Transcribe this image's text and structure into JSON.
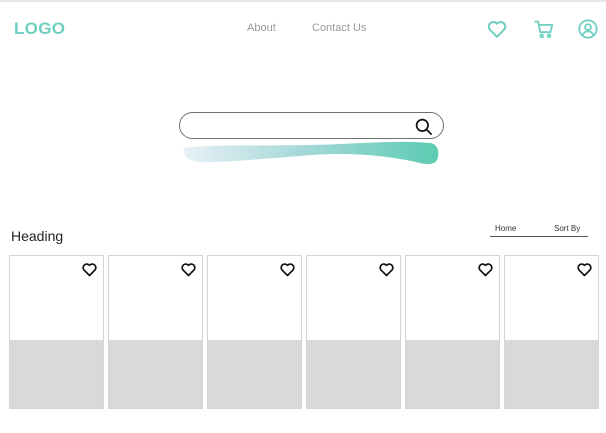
{
  "header": {
    "logo": "LOGO",
    "nav": [
      {
        "label": "About"
      },
      {
        "label": "Contact Us"
      }
    ],
    "icons": [
      "heart-icon",
      "cart-icon",
      "user-icon"
    ]
  },
  "search": {
    "placeholder": "",
    "value": "",
    "icon": "search-icon"
  },
  "section": {
    "heading": "Heading",
    "filters": [
      "Home",
      "Sort By"
    ]
  },
  "products": [
    {
      "favorite_icon": "heart-icon"
    },
    {
      "favorite_icon": "heart-icon"
    },
    {
      "favorite_icon": "heart-icon"
    },
    {
      "favorite_icon": "heart-icon"
    },
    {
      "favorite_icon": "heart-icon"
    },
    {
      "favorite_icon": "heart-icon"
    }
  ],
  "colors": {
    "brand": "#6fcfc0",
    "muted_text": "#9a9a9a",
    "placeholder_gray": "#d9d9d9",
    "wave_start": "#e8f1f7",
    "wave_end": "#5ccbb2"
  }
}
